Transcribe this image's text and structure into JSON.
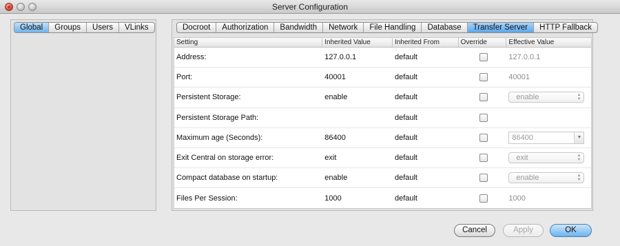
{
  "window": {
    "title": "Server Configuration"
  },
  "left_tabs": [
    {
      "label": "Global",
      "active": true
    },
    {
      "label": "Groups",
      "active": false
    },
    {
      "label": "Users",
      "active": false
    },
    {
      "label": "VLinks",
      "active": false
    }
  ],
  "right_tabs": [
    {
      "label": "Docroot",
      "active": false
    },
    {
      "label": "Authorization",
      "active": false
    },
    {
      "label": "Bandwidth",
      "active": false
    },
    {
      "label": "Network",
      "active": false
    },
    {
      "label": "File Handling",
      "active": false
    },
    {
      "label": "Database",
      "active": false
    },
    {
      "label": "Transfer Server",
      "active": true
    },
    {
      "label": "HTTP Fallback",
      "active": false
    }
  ],
  "table": {
    "headers": [
      "Setting",
      "Inherited Value",
      "Inherited From",
      "Override",
      "Effective Value"
    ],
    "rows": [
      {
        "setting": "Address:",
        "inherited_value": "127.0.0.1",
        "inherited_from": "default",
        "override": false,
        "effective_value": "127.0.0.1",
        "effective_type": "text"
      },
      {
        "setting": "Port:",
        "inherited_value": "40001",
        "inherited_from": "default",
        "override": false,
        "effective_value": "40001",
        "effective_type": "text"
      },
      {
        "setting": "Persistent Storage:",
        "inherited_value": "enable",
        "inherited_from": "default",
        "override": false,
        "effective_value": "enable",
        "effective_type": "popup"
      },
      {
        "setting": "Persistent Storage Path:",
        "inherited_value": "",
        "inherited_from": "default",
        "override": false,
        "effective_value": "",
        "effective_type": "text"
      },
      {
        "setting": "Maximum age (Seconds):",
        "inherited_value": "86400",
        "inherited_from": "default",
        "override": false,
        "effective_value": "86400",
        "effective_type": "combo"
      },
      {
        "setting": "Exit Central on storage error:",
        "inherited_value": "exit",
        "inherited_from": "default",
        "override": false,
        "effective_value": "exit",
        "effective_type": "popup"
      },
      {
        "setting": "Compact database on startup:",
        "inherited_value": "enable",
        "inherited_from": "default",
        "override": false,
        "effective_value": "enable",
        "effective_type": "popup"
      },
      {
        "setting": "Files Per Session:",
        "inherited_value": "1000",
        "inherited_from": "default",
        "override": false,
        "effective_value": "1000",
        "effective_type": "text"
      }
    ]
  },
  "buttons": {
    "cancel": "Cancel",
    "apply": "Apply",
    "ok": "OK"
  },
  "colors": {
    "accent": "#6fb3ec",
    "window_bg": "#e8e8e8"
  }
}
